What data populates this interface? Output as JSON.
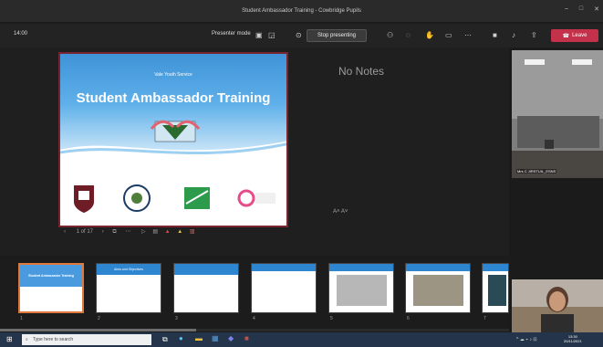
{
  "window": {
    "title": "Student Ambassador Training - Cowbridge Pupils"
  },
  "toolbar": {
    "time": "14:00",
    "presenter_mode": "Presenter mode",
    "stop_presenting": "Stop presenting",
    "leave": "Leave"
  },
  "slide": {
    "subtitle": "Vale Youth Service",
    "title": "Student Ambassador Training",
    "counter": "1 of 17"
  },
  "notes": {
    "text": "No Notes",
    "font_controls": "A˄  A˅"
  },
  "participant": {
    "name": "Mrs C JIRSTUIL_ESNS"
  },
  "thumbnails": [
    {
      "num": "1",
      "title": "Student Ambassador Training"
    },
    {
      "num": "2",
      "title": "Aims and Objectives"
    },
    {
      "num": "3",
      "title": ""
    },
    {
      "num": "4",
      "title": ""
    },
    {
      "num": "5",
      "title": ""
    },
    {
      "num": "6",
      "title": ""
    },
    {
      "num": "7",
      "title": ""
    }
  ],
  "taskbar": {
    "search_placeholder": "Type here to search",
    "clock_time": "13:30",
    "clock_date": "20/11/2021"
  },
  "colors": {
    "accent": "#c4314b",
    "slide_blue": "#3f93d7",
    "taskbar": "#24344a"
  }
}
